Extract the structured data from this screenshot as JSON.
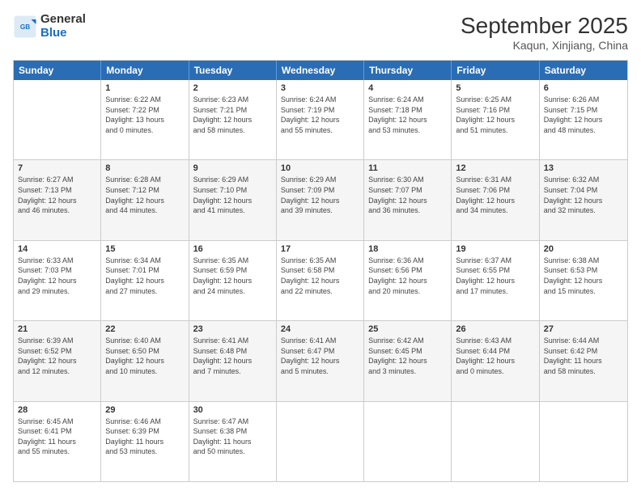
{
  "header": {
    "logo": {
      "line1": "General",
      "line2": "Blue"
    },
    "title": "September 2025",
    "location": "Kaqun, Xinjiang, China"
  },
  "days_of_week": [
    "Sunday",
    "Monday",
    "Tuesday",
    "Wednesday",
    "Thursday",
    "Friday",
    "Saturday"
  ],
  "weeks": [
    [
      {
        "day": "",
        "info": ""
      },
      {
        "day": "1",
        "info": "Sunrise: 6:22 AM\nSunset: 7:22 PM\nDaylight: 13 hours\nand 0 minutes."
      },
      {
        "day": "2",
        "info": "Sunrise: 6:23 AM\nSunset: 7:21 PM\nDaylight: 12 hours\nand 58 minutes."
      },
      {
        "day": "3",
        "info": "Sunrise: 6:24 AM\nSunset: 7:19 PM\nDaylight: 12 hours\nand 55 minutes."
      },
      {
        "day": "4",
        "info": "Sunrise: 6:24 AM\nSunset: 7:18 PM\nDaylight: 12 hours\nand 53 minutes."
      },
      {
        "day": "5",
        "info": "Sunrise: 6:25 AM\nSunset: 7:16 PM\nDaylight: 12 hours\nand 51 minutes."
      },
      {
        "day": "6",
        "info": "Sunrise: 6:26 AM\nSunset: 7:15 PM\nDaylight: 12 hours\nand 48 minutes."
      }
    ],
    [
      {
        "day": "7",
        "info": "Sunrise: 6:27 AM\nSunset: 7:13 PM\nDaylight: 12 hours\nand 46 minutes."
      },
      {
        "day": "8",
        "info": "Sunrise: 6:28 AM\nSunset: 7:12 PM\nDaylight: 12 hours\nand 44 minutes."
      },
      {
        "day": "9",
        "info": "Sunrise: 6:29 AM\nSunset: 7:10 PM\nDaylight: 12 hours\nand 41 minutes."
      },
      {
        "day": "10",
        "info": "Sunrise: 6:29 AM\nSunset: 7:09 PM\nDaylight: 12 hours\nand 39 minutes."
      },
      {
        "day": "11",
        "info": "Sunrise: 6:30 AM\nSunset: 7:07 PM\nDaylight: 12 hours\nand 36 minutes."
      },
      {
        "day": "12",
        "info": "Sunrise: 6:31 AM\nSunset: 7:06 PM\nDaylight: 12 hours\nand 34 minutes."
      },
      {
        "day": "13",
        "info": "Sunrise: 6:32 AM\nSunset: 7:04 PM\nDaylight: 12 hours\nand 32 minutes."
      }
    ],
    [
      {
        "day": "14",
        "info": "Sunrise: 6:33 AM\nSunset: 7:03 PM\nDaylight: 12 hours\nand 29 minutes."
      },
      {
        "day": "15",
        "info": "Sunrise: 6:34 AM\nSunset: 7:01 PM\nDaylight: 12 hours\nand 27 minutes."
      },
      {
        "day": "16",
        "info": "Sunrise: 6:35 AM\nSunset: 6:59 PM\nDaylight: 12 hours\nand 24 minutes."
      },
      {
        "day": "17",
        "info": "Sunrise: 6:35 AM\nSunset: 6:58 PM\nDaylight: 12 hours\nand 22 minutes."
      },
      {
        "day": "18",
        "info": "Sunrise: 6:36 AM\nSunset: 6:56 PM\nDaylight: 12 hours\nand 20 minutes."
      },
      {
        "day": "19",
        "info": "Sunrise: 6:37 AM\nSunset: 6:55 PM\nDaylight: 12 hours\nand 17 minutes."
      },
      {
        "day": "20",
        "info": "Sunrise: 6:38 AM\nSunset: 6:53 PM\nDaylight: 12 hours\nand 15 minutes."
      }
    ],
    [
      {
        "day": "21",
        "info": "Sunrise: 6:39 AM\nSunset: 6:52 PM\nDaylight: 12 hours\nand 12 minutes."
      },
      {
        "day": "22",
        "info": "Sunrise: 6:40 AM\nSunset: 6:50 PM\nDaylight: 12 hours\nand 10 minutes."
      },
      {
        "day": "23",
        "info": "Sunrise: 6:41 AM\nSunset: 6:48 PM\nDaylight: 12 hours\nand 7 minutes."
      },
      {
        "day": "24",
        "info": "Sunrise: 6:41 AM\nSunset: 6:47 PM\nDaylight: 12 hours\nand 5 minutes."
      },
      {
        "day": "25",
        "info": "Sunrise: 6:42 AM\nSunset: 6:45 PM\nDaylight: 12 hours\nand 3 minutes."
      },
      {
        "day": "26",
        "info": "Sunrise: 6:43 AM\nSunset: 6:44 PM\nDaylight: 12 hours\nand 0 minutes."
      },
      {
        "day": "27",
        "info": "Sunrise: 6:44 AM\nSunset: 6:42 PM\nDaylight: 11 hours\nand 58 minutes."
      }
    ],
    [
      {
        "day": "28",
        "info": "Sunrise: 6:45 AM\nSunset: 6:41 PM\nDaylight: 11 hours\nand 55 minutes."
      },
      {
        "day": "29",
        "info": "Sunrise: 6:46 AM\nSunset: 6:39 PM\nDaylight: 11 hours\nand 53 minutes."
      },
      {
        "day": "30",
        "info": "Sunrise: 6:47 AM\nSunset: 6:38 PM\nDaylight: 11 hours\nand 50 minutes."
      },
      {
        "day": "",
        "info": ""
      },
      {
        "day": "",
        "info": ""
      },
      {
        "day": "",
        "info": ""
      },
      {
        "day": "",
        "info": ""
      }
    ]
  ]
}
